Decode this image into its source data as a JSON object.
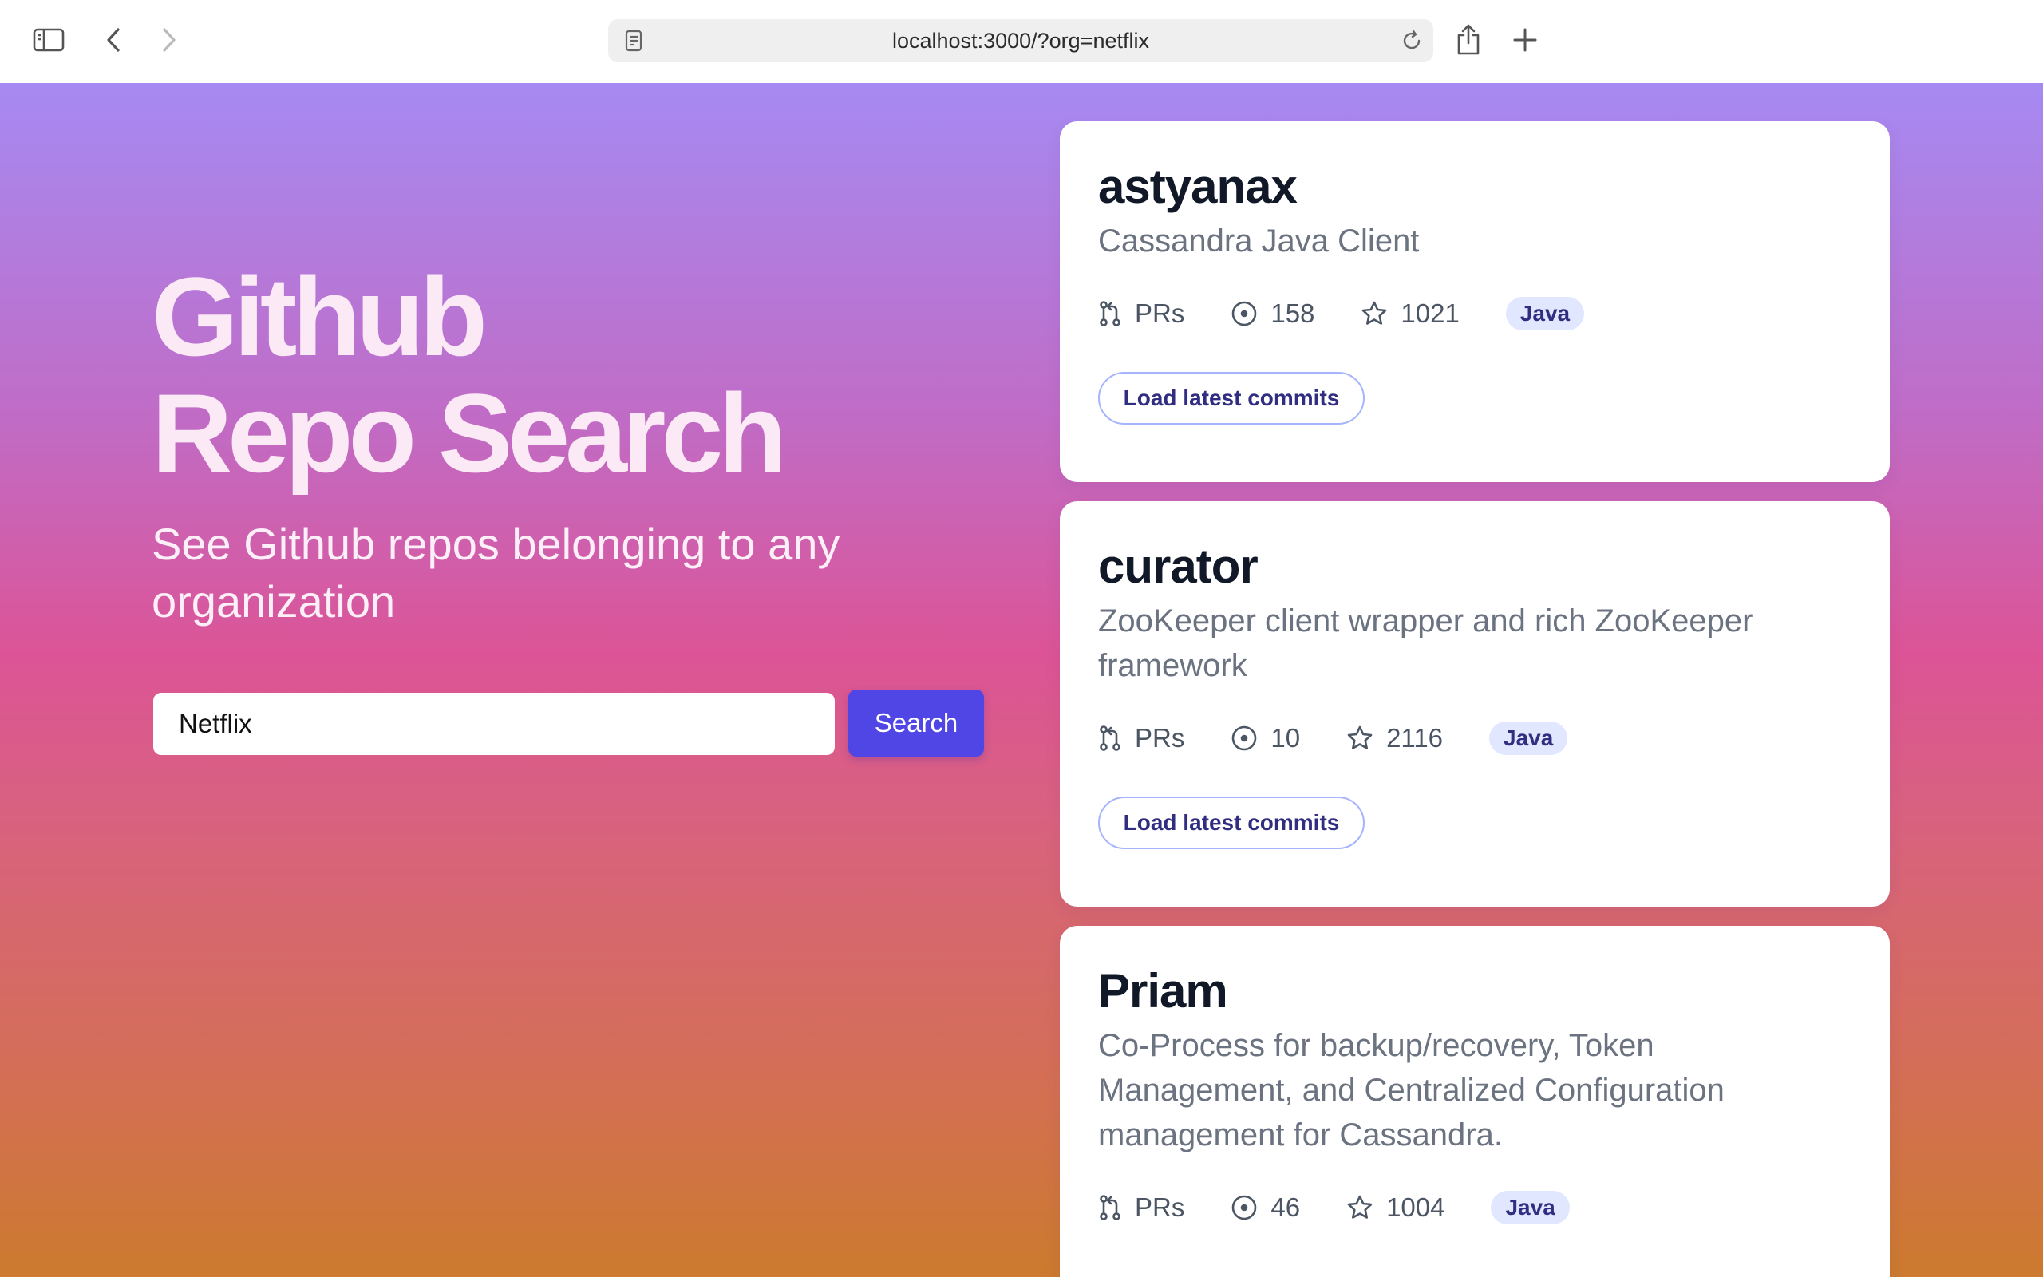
{
  "browser": {
    "url": "localhost:3000/?org=netflix"
  },
  "hero": {
    "title_line1": "Github",
    "title_line2": "Repo Search",
    "subtitle": "See Github repos belonging to any organization"
  },
  "search": {
    "value": "Netflix",
    "button_label": "Search"
  },
  "repos": [
    {
      "name": "astyanax",
      "description": "Cassandra Java Client",
      "prs_label": "PRs",
      "issues": "158",
      "stars": "1021",
      "language": "Java",
      "button_label": "Load latest commits"
    },
    {
      "name": "curator",
      "description": "ZooKeeper client wrapper and rich ZooKeeper framework",
      "prs_label": "PRs",
      "issues": "10",
      "stars": "2116",
      "language": "Java",
      "button_label": "Load latest commits"
    },
    {
      "name": "Priam",
      "description": "Co-Process for backup/recovery, Token Management, and Centralized Configuration management for Cassandra.",
      "prs_label": "PRs",
      "issues": "46",
      "stars": "1004",
      "language": "Java"
    }
  ],
  "colors": {
    "accent": "#4f46e5",
    "badge_bg": "#e0e7ff",
    "badge_text": "#312e81"
  }
}
